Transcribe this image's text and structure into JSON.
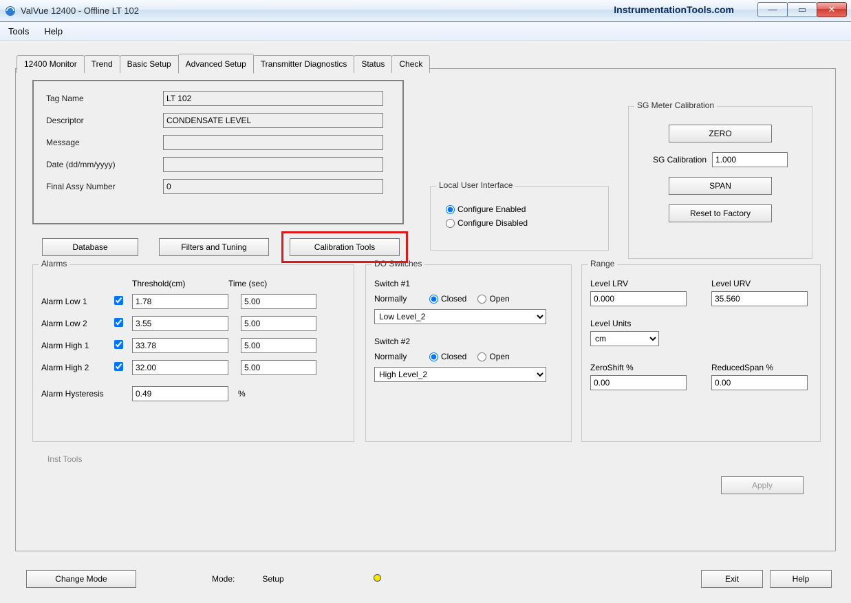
{
  "window": {
    "title": "ValVue 12400 - Offline  LT 102",
    "watermark": "InstrumentationTools.com"
  },
  "menu": {
    "tools": "Tools",
    "help": "Help"
  },
  "tabs": {
    "monitor": "12400 Monitor",
    "trend": "Trend",
    "basic": "Basic Setup",
    "advanced": "Advanced Setup",
    "diag": "Transmitter Diagnostics",
    "status": "Status",
    "check": "Check"
  },
  "info": {
    "tag_label": "Tag Name",
    "tag_value": "LT 102",
    "desc_label": "Descriptor",
    "desc_value": "CONDENSATE LEVEL",
    "msg_label": "Message",
    "msg_value": "",
    "date_label": "Date (dd/mm/yyyy)",
    "date_value": "",
    "assy_label": "Final Assy Number",
    "assy_value": "0"
  },
  "buttons": {
    "database": "Database",
    "filters": "Filters and Tuning",
    "caltools": "Calibration Tools",
    "apply": "Apply",
    "change_mode": "Change Mode",
    "exit": "Exit",
    "help": "Help"
  },
  "alarms": {
    "legend": "Alarms",
    "thr_hdr": "Threshold(cm)",
    "time_hdr": "Time (sec)",
    "rows": [
      {
        "label": "Alarm Low 1",
        "checked": true,
        "thr": "1.78",
        "time": "5.00"
      },
      {
        "label": "Alarm Low 2",
        "checked": true,
        "thr": "3.55",
        "time": "5.00"
      },
      {
        "label": "Alarm High 1",
        "checked": true,
        "thr": "33.78",
        "time": "5.00"
      },
      {
        "label": "Alarm High 2",
        "checked": true,
        "thr": "32.00",
        "time": "5.00"
      }
    ],
    "hyst_label": "Alarm Hysteresis",
    "hyst_value": "0.49",
    "hyst_unit": "%"
  },
  "do": {
    "legend": "DO Switches",
    "sw1_label": "Switch #1",
    "sw2_label": "Switch #2",
    "normally": "Normally",
    "closed": "Closed",
    "open": "Open",
    "sw1_sel": "Low Level_2",
    "sw2_sel": "High Level_2"
  },
  "lui": {
    "legend": "Local User Interface",
    "enabled": "Configure Enabled",
    "disabled": "Configure Disabled"
  },
  "sg": {
    "legend": "SG Meter Calibration",
    "zero": "ZERO",
    "span": "SPAN",
    "reset": "Reset to Factory",
    "cal_label": "SG Calibration",
    "cal_value": "1.000"
  },
  "range": {
    "legend": "Range",
    "lrv_label": "Level LRV",
    "lrv_value": "0.000",
    "urv_label": "Level URV",
    "urv_value": "35.560",
    "units_label": "Level Units",
    "units_value": "cm",
    "zeroshift_label": "ZeroShift %",
    "zeroshift_value": "0.00",
    "redspan_label": "ReducedSpan %",
    "redspan_value": "0.00"
  },
  "footer": {
    "mode_label": "Mode:",
    "mode_value": "Setup",
    "inst_tools": "Inst Tools"
  }
}
